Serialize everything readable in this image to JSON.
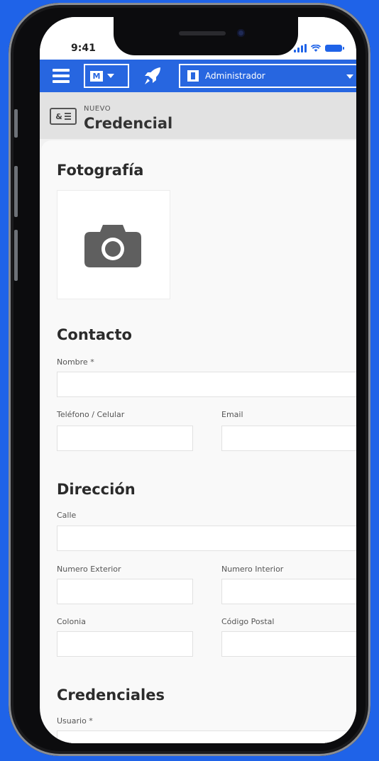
{
  "status": {
    "time": "9:41"
  },
  "navbar": {
    "store_badge": "M",
    "role_select_value": "Administrador"
  },
  "page": {
    "kicker": "NUEVO",
    "title": "Credencial",
    "id_card_glyph": "&"
  },
  "sections": {
    "photo": {
      "title": "Fotografía"
    },
    "contact": {
      "title": "Contacto",
      "name_label": "Nombre *",
      "phone_label": "Teléfono / Celular",
      "email_label": "Email"
    },
    "address": {
      "title": "Dirección",
      "street_label": "Calle",
      "ext_number_label": "Numero Exterior",
      "int_number_label": "Numero Interior",
      "colony_label": "Colonia",
      "zip_label": "Código Postal"
    },
    "credentials": {
      "title": "Credenciales",
      "user_label": "Usuario *"
    }
  },
  "icons": [
    "menu-icon",
    "caret-down-icon",
    "rocket-icon",
    "user-badge-icon",
    "id-card-icon",
    "camera-icon",
    "signal-icon",
    "wifi-icon",
    "battery-icon"
  ],
  "colors": {
    "brand_blue": "#2766e0",
    "background_blue": "#1f63e8"
  }
}
